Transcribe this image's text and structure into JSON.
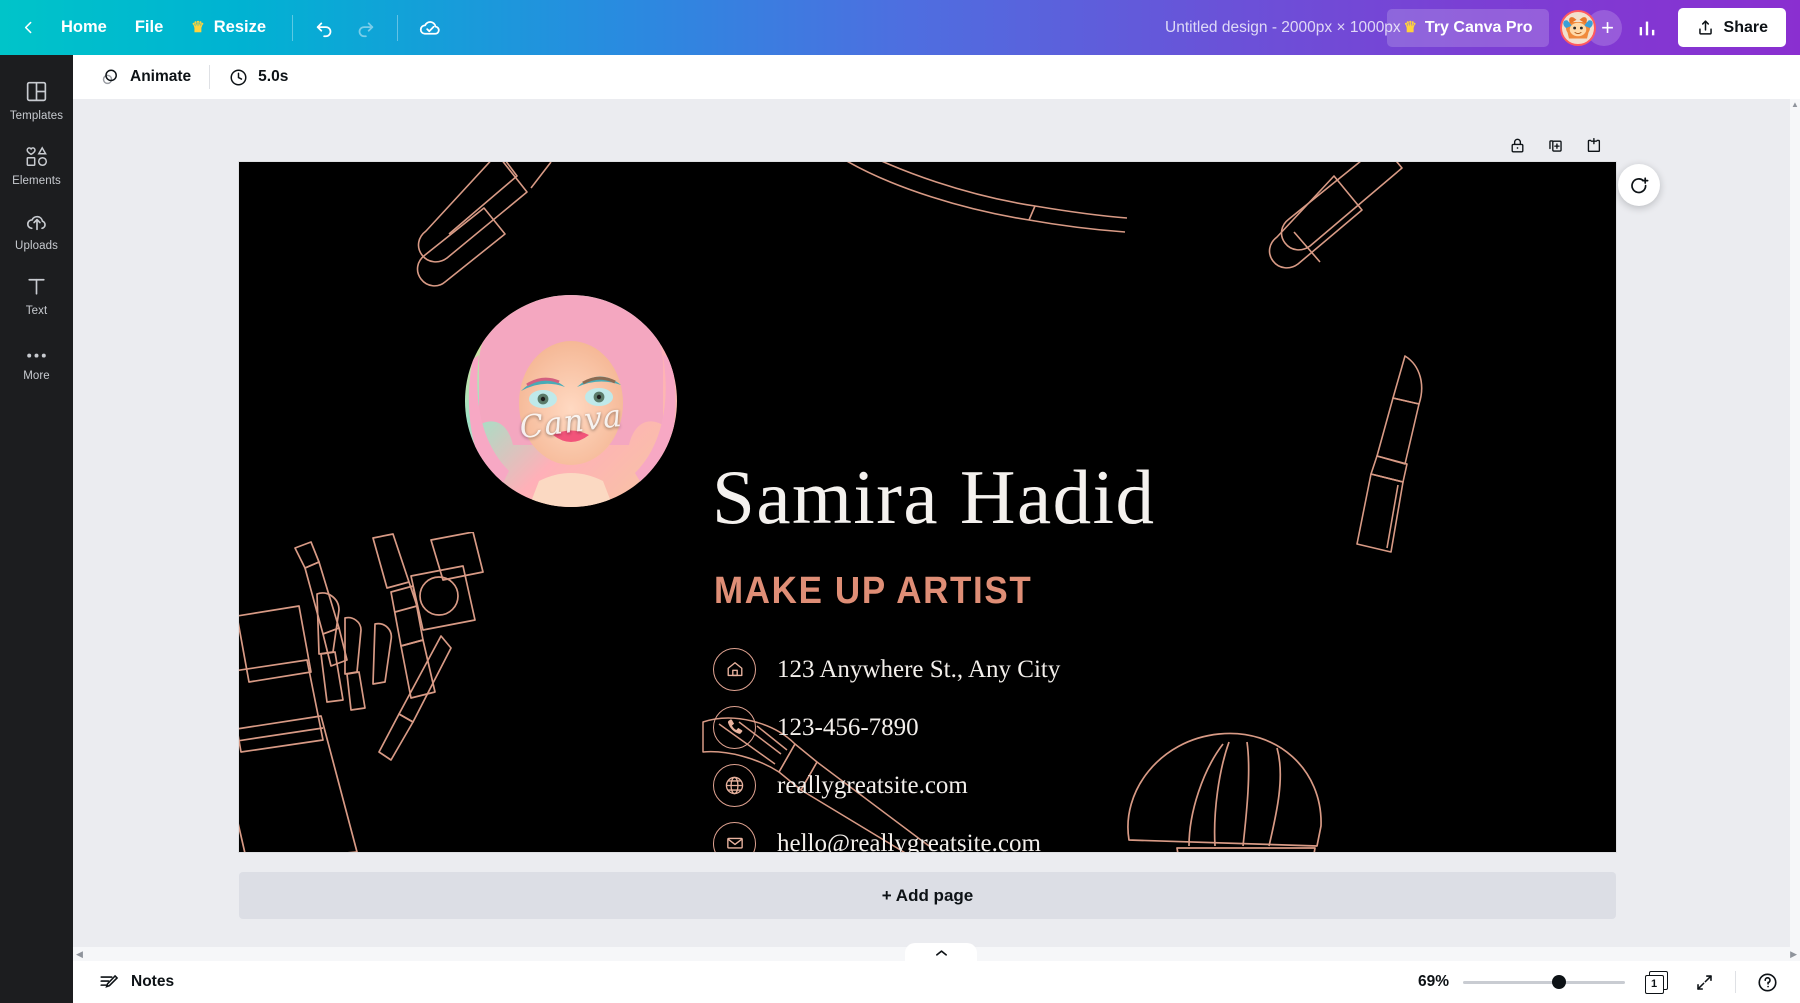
{
  "topbar": {
    "back_icon": "chevron-left-icon",
    "home_label": "Home",
    "file_label": "File",
    "resize_label": "Resize",
    "resize_crown": "♛",
    "undo_icon": "undo-icon",
    "redo_icon": "redo-icon",
    "cloud_saved_icon": "cloud-check-icon",
    "design_title": "Untitled design - 2000px × 1000px",
    "try_pro_label": "Try Canva Pro",
    "try_pro_crown": "♛",
    "avatar_name": "user-avatar",
    "add_member_label": "+",
    "insights_icon": "bar-chart-icon",
    "share_label": "Share",
    "gradient_start": "#00c4c9",
    "gradient_end": "#8a2fd0"
  },
  "sidebar": {
    "items": [
      {
        "label": "Templates",
        "icon": "templates-icon"
      },
      {
        "label": "Elements",
        "icon": "elements-icon"
      },
      {
        "label": "Uploads",
        "icon": "uploads-cloud-icon"
      },
      {
        "label": "Text",
        "icon": "text-icon"
      },
      {
        "label": "More",
        "icon": "more-dots-icon"
      }
    ]
  },
  "editor_toolbar": {
    "animate_label": "Animate",
    "animate_icon": "animate-circles-icon",
    "duration_label": "5.0s",
    "duration_icon": "clock-icon"
  },
  "canvas_tools": {
    "lock_icon": "lock-icon",
    "duplicate_icon": "duplicate-page-icon",
    "add_page_icon": "add-page-icon",
    "comment_icon": "add-comment-icon"
  },
  "design": {
    "background_color": "#000000",
    "accent_color": "#df8e76",
    "title": "Samira Hadid",
    "subtitle": "MAKE UP ARTIST",
    "watermark": "Canva",
    "contacts": [
      {
        "icon": "home-icon",
        "text": "123 Anywhere St., Any City"
      },
      {
        "icon": "phone-icon",
        "text": "123-456-7890"
      },
      {
        "icon": "globe-icon",
        "text": "reallygreatsite.com"
      },
      {
        "icon": "email-icon",
        "text": "hello@reallygreatsite.com"
      }
    ]
  },
  "add_page": {
    "label": "+ Add page"
  },
  "bottombar": {
    "notes_label": "Notes",
    "notes_icon": "notes-pencil-icon",
    "zoom_level": "69%",
    "page_number": "1",
    "pages_icon": "pages-icon",
    "fullscreen_icon": "expand-icon",
    "help_icon": "help-icon"
  }
}
